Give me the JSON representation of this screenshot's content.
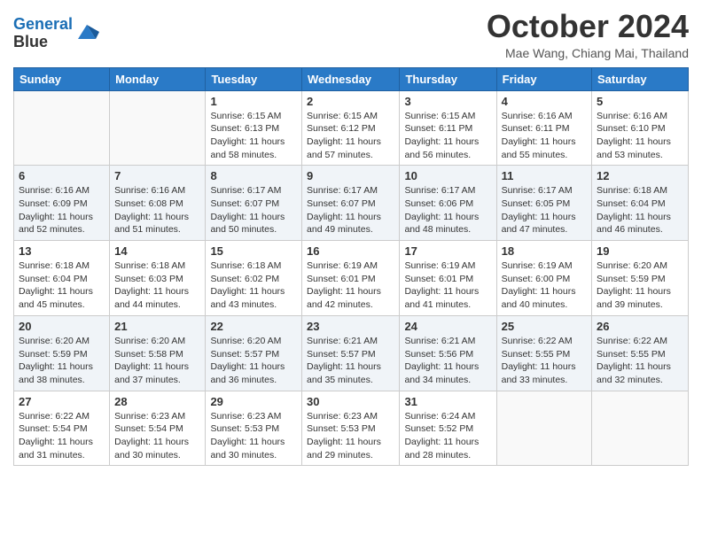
{
  "header": {
    "logo_line1": "General",
    "logo_line2": "Blue",
    "month_title": "October 2024",
    "subtitle": "Mae Wang, Chiang Mai, Thailand"
  },
  "weekdays": [
    "Sunday",
    "Monday",
    "Tuesday",
    "Wednesday",
    "Thursday",
    "Friday",
    "Saturday"
  ],
  "weeks": [
    [
      {
        "day": "",
        "sunrise": "",
        "sunset": "",
        "daylight": ""
      },
      {
        "day": "",
        "sunrise": "",
        "sunset": "",
        "daylight": ""
      },
      {
        "day": "1",
        "sunrise": "Sunrise: 6:15 AM",
        "sunset": "Sunset: 6:13 PM",
        "daylight": "Daylight: 11 hours and 58 minutes."
      },
      {
        "day": "2",
        "sunrise": "Sunrise: 6:15 AM",
        "sunset": "Sunset: 6:12 PM",
        "daylight": "Daylight: 11 hours and 57 minutes."
      },
      {
        "day": "3",
        "sunrise": "Sunrise: 6:15 AM",
        "sunset": "Sunset: 6:11 PM",
        "daylight": "Daylight: 11 hours and 56 minutes."
      },
      {
        "day": "4",
        "sunrise": "Sunrise: 6:16 AM",
        "sunset": "Sunset: 6:11 PM",
        "daylight": "Daylight: 11 hours and 55 minutes."
      },
      {
        "day": "5",
        "sunrise": "Sunrise: 6:16 AM",
        "sunset": "Sunset: 6:10 PM",
        "daylight": "Daylight: 11 hours and 53 minutes."
      }
    ],
    [
      {
        "day": "6",
        "sunrise": "Sunrise: 6:16 AM",
        "sunset": "Sunset: 6:09 PM",
        "daylight": "Daylight: 11 hours and 52 minutes."
      },
      {
        "day": "7",
        "sunrise": "Sunrise: 6:16 AM",
        "sunset": "Sunset: 6:08 PM",
        "daylight": "Daylight: 11 hours and 51 minutes."
      },
      {
        "day": "8",
        "sunrise": "Sunrise: 6:17 AM",
        "sunset": "Sunset: 6:07 PM",
        "daylight": "Daylight: 11 hours and 50 minutes."
      },
      {
        "day": "9",
        "sunrise": "Sunrise: 6:17 AM",
        "sunset": "Sunset: 6:07 PM",
        "daylight": "Daylight: 11 hours and 49 minutes."
      },
      {
        "day": "10",
        "sunrise": "Sunrise: 6:17 AM",
        "sunset": "Sunset: 6:06 PM",
        "daylight": "Daylight: 11 hours and 48 minutes."
      },
      {
        "day": "11",
        "sunrise": "Sunrise: 6:17 AM",
        "sunset": "Sunset: 6:05 PM",
        "daylight": "Daylight: 11 hours and 47 minutes."
      },
      {
        "day": "12",
        "sunrise": "Sunrise: 6:18 AM",
        "sunset": "Sunset: 6:04 PM",
        "daylight": "Daylight: 11 hours and 46 minutes."
      }
    ],
    [
      {
        "day": "13",
        "sunrise": "Sunrise: 6:18 AM",
        "sunset": "Sunset: 6:04 PM",
        "daylight": "Daylight: 11 hours and 45 minutes."
      },
      {
        "day": "14",
        "sunrise": "Sunrise: 6:18 AM",
        "sunset": "Sunset: 6:03 PM",
        "daylight": "Daylight: 11 hours and 44 minutes."
      },
      {
        "day": "15",
        "sunrise": "Sunrise: 6:18 AM",
        "sunset": "Sunset: 6:02 PM",
        "daylight": "Daylight: 11 hours and 43 minutes."
      },
      {
        "day": "16",
        "sunrise": "Sunrise: 6:19 AM",
        "sunset": "Sunset: 6:01 PM",
        "daylight": "Daylight: 11 hours and 42 minutes."
      },
      {
        "day": "17",
        "sunrise": "Sunrise: 6:19 AM",
        "sunset": "Sunset: 6:01 PM",
        "daylight": "Daylight: 11 hours and 41 minutes."
      },
      {
        "day": "18",
        "sunrise": "Sunrise: 6:19 AM",
        "sunset": "Sunset: 6:00 PM",
        "daylight": "Daylight: 11 hours and 40 minutes."
      },
      {
        "day": "19",
        "sunrise": "Sunrise: 6:20 AM",
        "sunset": "Sunset: 5:59 PM",
        "daylight": "Daylight: 11 hours and 39 minutes."
      }
    ],
    [
      {
        "day": "20",
        "sunrise": "Sunrise: 6:20 AM",
        "sunset": "Sunset: 5:59 PM",
        "daylight": "Daylight: 11 hours and 38 minutes."
      },
      {
        "day": "21",
        "sunrise": "Sunrise: 6:20 AM",
        "sunset": "Sunset: 5:58 PM",
        "daylight": "Daylight: 11 hours and 37 minutes."
      },
      {
        "day": "22",
        "sunrise": "Sunrise: 6:20 AM",
        "sunset": "Sunset: 5:57 PM",
        "daylight": "Daylight: 11 hours and 36 minutes."
      },
      {
        "day": "23",
        "sunrise": "Sunrise: 6:21 AM",
        "sunset": "Sunset: 5:57 PM",
        "daylight": "Daylight: 11 hours and 35 minutes."
      },
      {
        "day": "24",
        "sunrise": "Sunrise: 6:21 AM",
        "sunset": "Sunset: 5:56 PM",
        "daylight": "Daylight: 11 hours and 34 minutes."
      },
      {
        "day": "25",
        "sunrise": "Sunrise: 6:22 AM",
        "sunset": "Sunset: 5:55 PM",
        "daylight": "Daylight: 11 hours and 33 minutes."
      },
      {
        "day": "26",
        "sunrise": "Sunrise: 6:22 AM",
        "sunset": "Sunset: 5:55 PM",
        "daylight": "Daylight: 11 hours and 32 minutes."
      }
    ],
    [
      {
        "day": "27",
        "sunrise": "Sunrise: 6:22 AM",
        "sunset": "Sunset: 5:54 PM",
        "daylight": "Daylight: 11 hours and 31 minutes."
      },
      {
        "day": "28",
        "sunrise": "Sunrise: 6:23 AM",
        "sunset": "Sunset: 5:54 PM",
        "daylight": "Daylight: 11 hours and 30 minutes."
      },
      {
        "day": "29",
        "sunrise": "Sunrise: 6:23 AM",
        "sunset": "Sunset: 5:53 PM",
        "daylight": "Daylight: 11 hours and 30 minutes."
      },
      {
        "day": "30",
        "sunrise": "Sunrise: 6:23 AM",
        "sunset": "Sunset: 5:53 PM",
        "daylight": "Daylight: 11 hours and 29 minutes."
      },
      {
        "day": "31",
        "sunrise": "Sunrise: 6:24 AM",
        "sunset": "Sunset: 5:52 PM",
        "daylight": "Daylight: 11 hours and 28 minutes."
      },
      {
        "day": "",
        "sunrise": "",
        "sunset": "",
        "daylight": ""
      },
      {
        "day": "",
        "sunrise": "",
        "sunset": "",
        "daylight": ""
      }
    ]
  ]
}
